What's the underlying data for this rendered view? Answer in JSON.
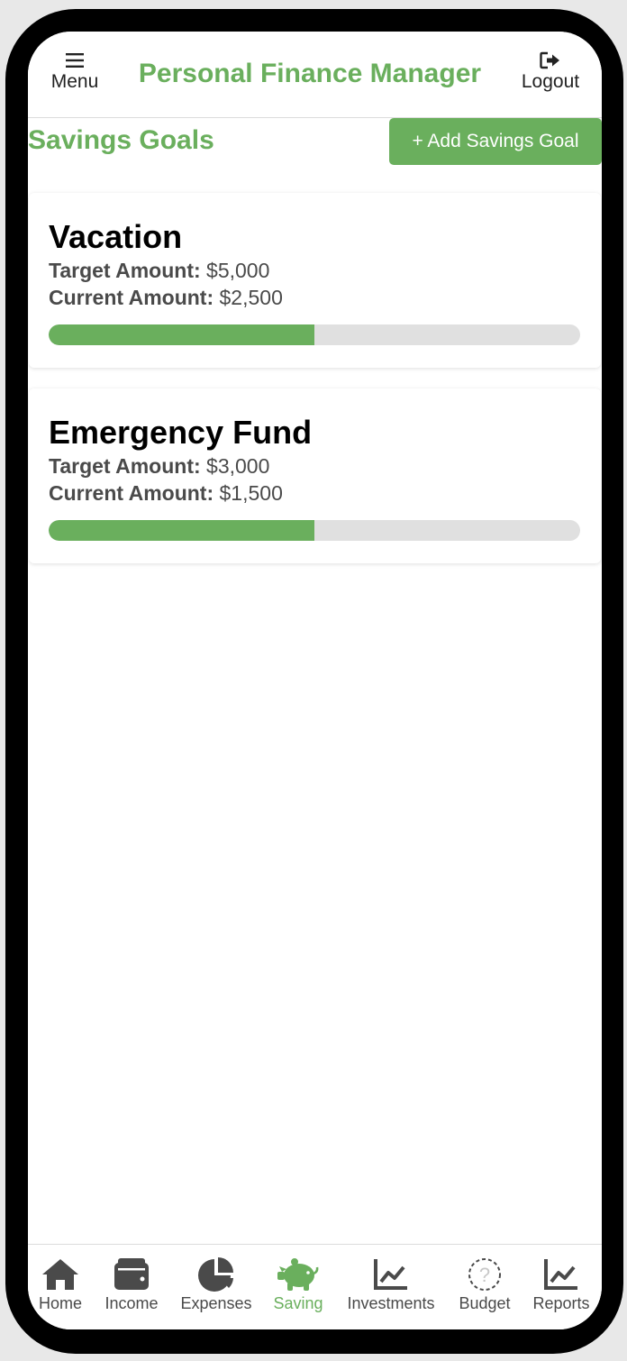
{
  "header": {
    "menu_label": "Menu",
    "title": "Personal Finance Manager",
    "logout_label": "Logout"
  },
  "section": {
    "title": "Savings Goals",
    "add_button_label": "+ Add Savings Goal"
  },
  "labels": {
    "target": "Target Amount:",
    "current": "Current Amount:"
  },
  "goals": [
    {
      "name": "Vacation",
      "target": "$5,000",
      "current": "$2,500",
      "progress": 0.5
    },
    {
      "name": "Emergency Fund",
      "target": "$3,000",
      "current": "$1,500",
      "progress": 0.5
    }
  ],
  "nav": {
    "items": [
      {
        "label": "Home",
        "icon": "home-icon"
      },
      {
        "label": "Income",
        "icon": "wallet-icon"
      },
      {
        "label": "Expenses",
        "icon": "pie-chart-icon"
      },
      {
        "label": "Saving",
        "icon": "piggy-bank-icon",
        "active": true
      },
      {
        "label": "Investments",
        "icon": "line-chart-icon"
      },
      {
        "label": "Budget",
        "icon": "question-circle-icon"
      },
      {
        "label": "Reports",
        "icon": "line-chart-icon"
      }
    ]
  },
  "colors": {
    "accent": "#6aaf5d",
    "text": "#4a4a4a",
    "track": "#e0e0e0"
  }
}
